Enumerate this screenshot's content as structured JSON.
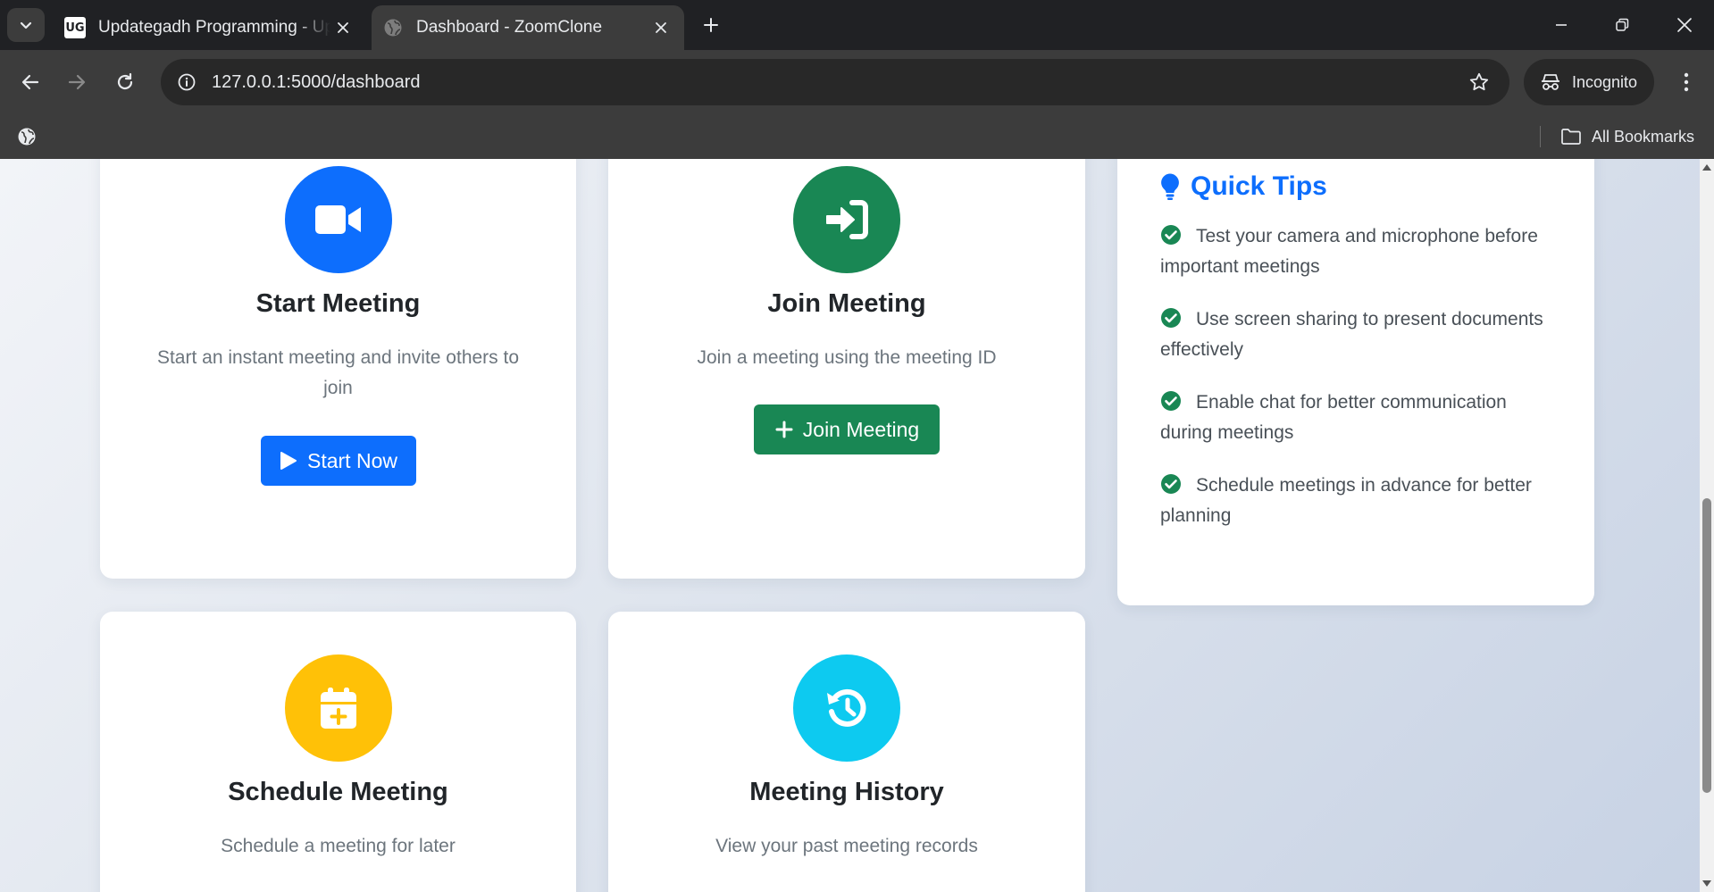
{
  "browser": {
    "tabs": [
      {
        "title": "Updategadh Programming - Up",
        "favicon": "UG"
      },
      {
        "title": "Dashboard - ZoomClone",
        "favicon": "globe-icon"
      }
    ],
    "url": "127.0.0.1:5000/dashboard",
    "incognito_label": "Incognito",
    "bookmarks_label": "All Bookmarks"
  },
  "cards": {
    "start": {
      "title": "Start Meeting",
      "description": "Start an instant meeting and invite others to join",
      "button": "Start Now",
      "icon": "video-icon",
      "color": "#0d6efd"
    },
    "join": {
      "title": "Join Meeting",
      "description": "Join a meeting using the meeting ID",
      "button": "Join Meeting",
      "icon": "sign-in-icon",
      "color": "#198754"
    },
    "schedule": {
      "title": "Schedule Meeting",
      "description": "Schedule a meeting for later",
      "icon": "calendar-plus-icon",
      "color": "#ffc107"
    },
    "history": {
      "title": "Meeting History",
      "description": "View your past meeting records",
      "icon": "history-icon",
      "color": "#0dcaf0"
    }
  },
  "tips": {
    "title": "Quick Tips",
    "icon": "lightbulb-icon",
    "color": "#0d6efd",
    "check_color": "#198754",
    "items": [
      "Test your camera and microphone before important meetings",
      "Use screen sharing to present documents effectively",
      "Enable chat for better communication during meetings",
      "Schedule meetings in advance for better planning"
    ]
  }
}
